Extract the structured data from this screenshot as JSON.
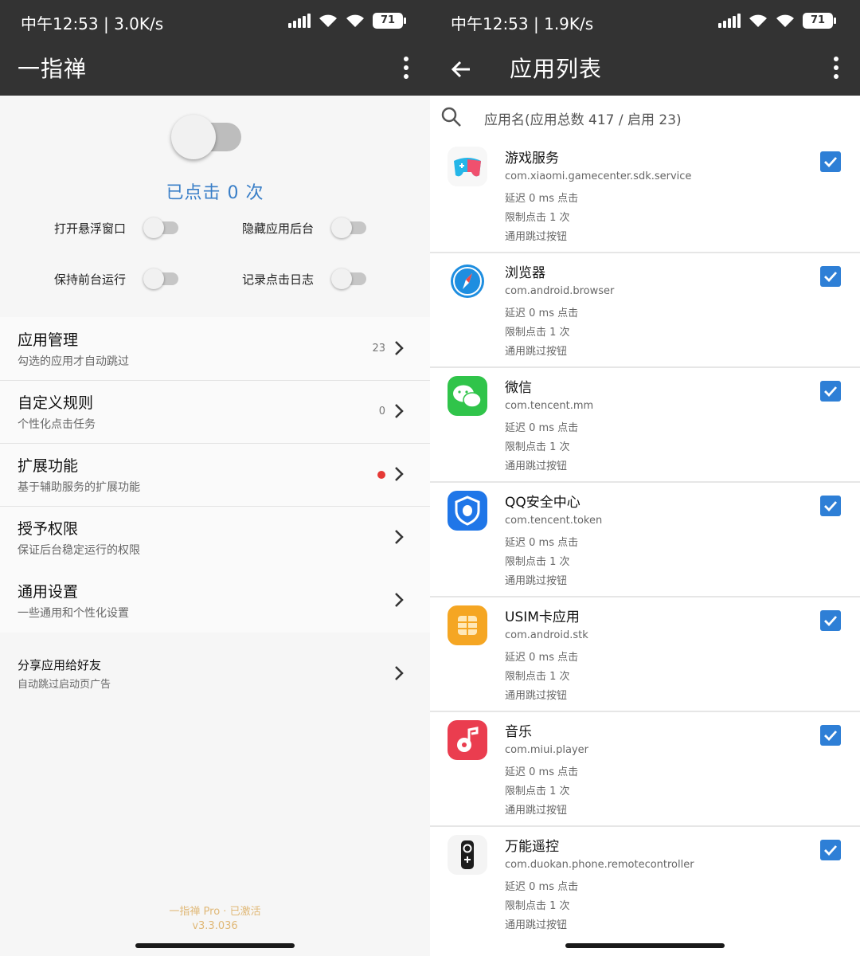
{
  "left": {
    "status": {
      "text": "中午12:53 | 3.0K/s",
      "battery": "71"
    },
    "appbar": {
      "title": "一指禅"
    },
    "hero": {
      "click_count": "已点击 0 次"
    },
    "options": [
      {
        "label": "打开悬浮窗口"
      },
      {
        "label": "隐藏应用后台"
      },
      {
        "label": "保持前台运行"
      },
      {
        "label": "记录点击日志"
      }
    ],
    "menu": [
      {
        "title": "应用管理",
        "subtitle": "勾选的应用才自动跳过",
        "badge": "23"
      },
      {
        "title": "自定义规则",
        "subtitle": "个性化点击任务",
        "badge": "0"
      },
      {
        "title": "扩展功能",
        "subtitle": "基于辅助服务的扩展功能",
        "badge": ""
      },
      {
        "title": "授予权限",
        "subtitle": "保证后台稳定运行的权限",
        "badge": ""
      },
      {
        "title": "通用设置",
        "subtitle": "一些通用和个性化设置",
        "badge": ""
      }
    ],
    "share": {
      "title": "分享应用给好友",
      "subtitle": "自动跳过启动页广告"
    },
    "footer": {
      "line1": "一指禅 Pro · 已激活",
      "line2": "v3.3.036"
    }
  },
  "right": {
    "status": {
      "text": "中午12:53 | 1.9K/s",
      "battery": "71"
    },
    "appbar": {
      "title": "应用列表"
    },
    "search": {
      "placeholder": "应用名(应用总数 417 / 启用 23)"
    },
    "apps": [
      {
        "name": "游戏服务",
        "package": "com.xiaomi.gamecenter.sdk.service",
        "delay": "延迟 0 ms 点击",
        "limit": "限制点击 1 次",
        "rule": "通用跳过按钮",
        "checked": true,
        "icon": "gamepad-icon"
      },
      {
        "name": "浏览器",
        "package": "com.android.browser",
        "delay": "延迟 0 ms 点击",
        "limit": "限制点击 1 次",
        "rule": "通用跳过按钮",
        "checked": true,
        "icon": "compass-icon"
      },
      {
        "name": "微信",
        "package": "com.tencent.mm",
        "delay": "延迟 0 ms 点击",
        "limit": "限制点击 1 次",
        "rule": "通用跳过按钮",
        "checked": true,
        "icon": "chat-bubbles-icon"
      },
      {
        "name": "QQ安全中心",
        "package": "com.tencent.token",
        "delay": "延迟 0 ms 点击",
        "limit": "限制点击 1 次",
        "rule": "通用跳过按钮",
        "checked": true,
        "icon": "shield-icon"
      },
      {
        "name": "USIM卡应用",
        "package": "com.android.stk",
        "delay": "延迟 0 ms 点击",
        "limit": "限制点击 1 次",
        "rule": "通用跳过按钮",
        "checked": true,
        "icon": "sim-card-icon"
      },
      {
        "name": "音乐",
        "package": "com.miui.player",
        "delay": "延迟 0 ms 点击",
        "limit": "限制点击 1 次",
        "rule": "通用跳过按钮",
        "checked": true,
        "icon": "music-note-icon"
      },
      {
        "name": "万能遥控",
        "package": "com.duokan.phone.remotecontroller",
        "delay": "延迟 0 ms 点击",
        "limit": "限制点击 1 次",
        "rule": "通用跳过按钮",
        "checked": true,
        "icon": "remote-control-icon"
      }
    ]
  },
  "colors": {
    "appbar": "#333333",
    "accent": "#3a7fc8",
    "checkbox": "#2e7fd6",
    "footer": "#e0b877",
    "red_dot": "#e53935"
  }
}
